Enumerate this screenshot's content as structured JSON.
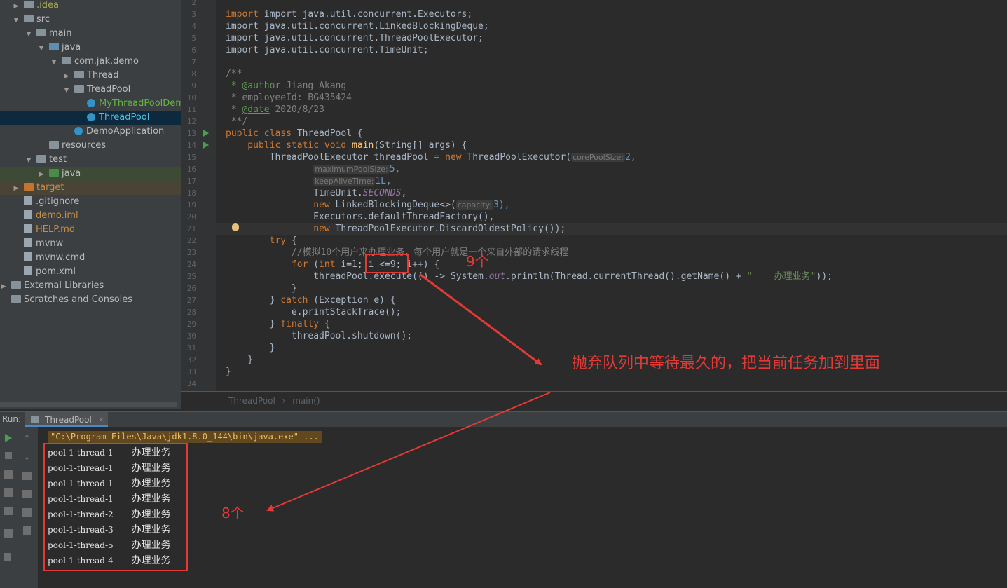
{
  "tree": {
    "items": [
      {
        "label": ".idea",
        "arrow": "▶",
        "icon": "f-gray",
        "text": "t-olive"
      },
      {
        "label": "src",
        "arrow": "▼",
        "icon": "f-gray",
        "text": ""
      },
      {
        "label": "main",
        "arrow": "▼",
        "icon": "f-gray",
        "text": ""
      },
      {
        "label": "java",
        "arrow": "▼",
        "icon": "f-blue",
        "text": ""
      },
      {
        "label": "com.jak.demo",
        "arrow": "▼",
        "icon": "f-pkg",
        "text": ""
      },
      {
        "label": "Thread",
        "arrow": "▶",
        "icon": "f-pkg",
        "text": ""
      },
      {
        "label": "TreadPool",
        "arrow": "▼",
        "icon": "f-pkg",
        "text": ""
      },
      {
        "label": "MyThreadPoolDemo",
        "arrow": "",
        "icon": "class",
        "text": "t-green"
      },
      {
        "label": "ThreadPool",
        "arrow": "",
        "icon": "class",
        "text": "t-green"
      },
      {
        "label": "DemoApplication",
        "arrow": "",
        "icon": "class",
        "text": ""
      },
      {
        "label": "resources",
        "arrow": "",
        "icon": "f-gray",
        "text": ""
      },
      {
        "label": "test",
        "arrow": "▼",
        "icon": "f-gray",
        "text": ""
      },
      {
        "label": "java",
        "arrow": "▶",
        "icon": "f-green",
        "text": ""
      },
      {
        "label": "target",
        "arrow": "▶",
        "icon": "f-orange",
        "text": "t-orange"
      },
      {
        "label": ".gitignore",
        "arrow": "",
        "icon": "doc",
        "text": ""
      },
      {
        "label": "demo.iml",
        "arrow": "",
        "icon": "doc",
        "text": "t-orange"
      },
      {
        "label": "HELP.md",
        "arrow": "",
        "icon": "doc",
        "text": "t-orange"
      },
      {
        "label": "mvnw",
        "arrow": "",
        "icon": "doc",
        "text": ""
      },
      {
        "label": "mvnw.cmd",
        "arrow": "",
        "icon": "doc",
        "text": ""
      },
      {
        "label": "pom.xml",
        "arrow": "",
        "icon": "doc",
        "text": ""
      },
      {
        "label": "External Libraries",
        "arrow": "▶",
        "icon": "f-gray",
        "text": ""
      },
      {
        "label": "Scratches and Consoles",
        "arrow": "",
        "icon": "f-gray",
        "text": ""
      }
    ]
  },
  "editor": {
    "line_numbers": [
      "2",
      "3",
      "4",
      "5",
      "6",
      "7",
      "8",
      "9",
      "10",
      "11",
      "12",
      "13",
      "14",
      "15",
      "16",
      "17",
      "18",
      "19",
      "20",
      "21",
      "22",
      "23",
      "24",
      "25",
      "26",
      "27",
      "28",
      "29",
      "30",
      "31",
      "32",
      "33",
      "34"
    ],
    "code": {
      "l3": "import java.util.concurrent.Executors;",
      "l4": "import java.util.concurrent.LinkedBlockingDeque;",
      "l5": "import java.util.concurrent.ThreadPoolExecutor;",
      "l6": "import java.util.concurrent.TimeUnit;",
      "l8": "/**",
      "l9a": " * @author",
      "l9b": " Jiang Akang",
      "l10": " * employeeId: BG435424",
      "l11a": " * ",
      "l11b": "@date",
      "l11c": " 2020/8/23",
      "l12": " **/",
      "l13a": "public class ",
      "l13b": "ThreadPool {",
      "l14a": "    public static void ",
      "l14b": "main",
      "l14c": "(String[] args) {",
      "l15a": "        ThreadPoolExecutor threadPool = ",
      "l15b": "new ",
      "l15c": "ThreadPoolExecutor(",
      "l15hint": "corePoolSize:",
      "l15d": "2,",
      "l16hint": "maximumPoolSize:",
      "l16d": "5,",
      "l17hint": "keepAliveTime:",
      "l17d": "1L,",
      "l18a": "                TimeUnit.",
      "l18b": "SECONDS",
      "l18c": ",",
      "l19a": "                ",
      "l19b": "new ",
      "l19c": "LinkedBlockingDeque<>(",
      "l19hint": "capacity:",
      "l19d": "3),",
      "l20": "                Executors.defaultThreadFactory(),",
      "l21a": "                ",
      "l21b": "new ",
      "l21c": "ThreadPoolExecutor.DiscardOldestPolicy());",
      "l22a": "        ",
      "l22b": "try ",
      "l22c": "{",
      "l23": "            //模拟10个用户来办理业务，每个用户就是一个来自外部的请求线程",
      "l24a": "            ",
      "l24b": "for ",
      "l24c": "(",
      "l24d": "int ",
      "l24e": "i=1; i <=9; i++) {",
      "l25a": "                threadPool.execute(() -> System.",
      "l25b": "out",
      "l25c": ".println(Thread.currentThread().getName() + ",
      "l25d": "\"    办理业务\"",
      "l25e": "));",
      "l26": "            }",
      "l27a": "        } ",
      "l27b": "catch ",
      "l27c": "(Exception e) {",
      "l28": "            e.printStackTrace();",
      "l29a": "        } ",
      "l29b": "finally ",
      "l29c": "{",
      "l30": "            threadPool.shutdown();",
      "l31": "        }",
      "l32": "    }",
      "l33": "}"
    },
    "breadcrumb": [
      "ThreadPool",
      "main()"
    ]
  },
  "run": {
    "label": "Run:",
    "tab": "ThreadPool",
    "tab_close": "×",
    "command": "\"C:\\Program Files\\Java\\jdk1.8.0_144\\bin\\java.exe\" ...",
    "output": [
      {
        "thread": "pool-1-thread-1",
        "msg": "办理业务"
      },
      {
        "thread": "pool-1-thread-1",
        "msg": "办理业务"
      },
      {
        "thread": "pool-1-thread-1",
        "msg": "办理业务"
      },
      {
        "thread": "pool-1-thread-1",
        "msg": "办理业务"
      },
      {
        "thread": "pool-1-thread-2",
        "msg": "办理业务"
      },
      {
        "thread": "pool-1-thread-3",
        "msg": "办理业务"
      },
      {
        "thread": "pool-1-thread-5",
        "msg": "办理业务"
      },
      {
        "thread": "pool-1-thread-4",
        "msg": "办理业务"
      }
    ]
  },
  "annotations": {
    "nine": "9个",
    "explain": "抛弃队列中等待最久的，把当前任务加到里面",
    "eight": "8个",
    "color": "#e53935"
  }
}
